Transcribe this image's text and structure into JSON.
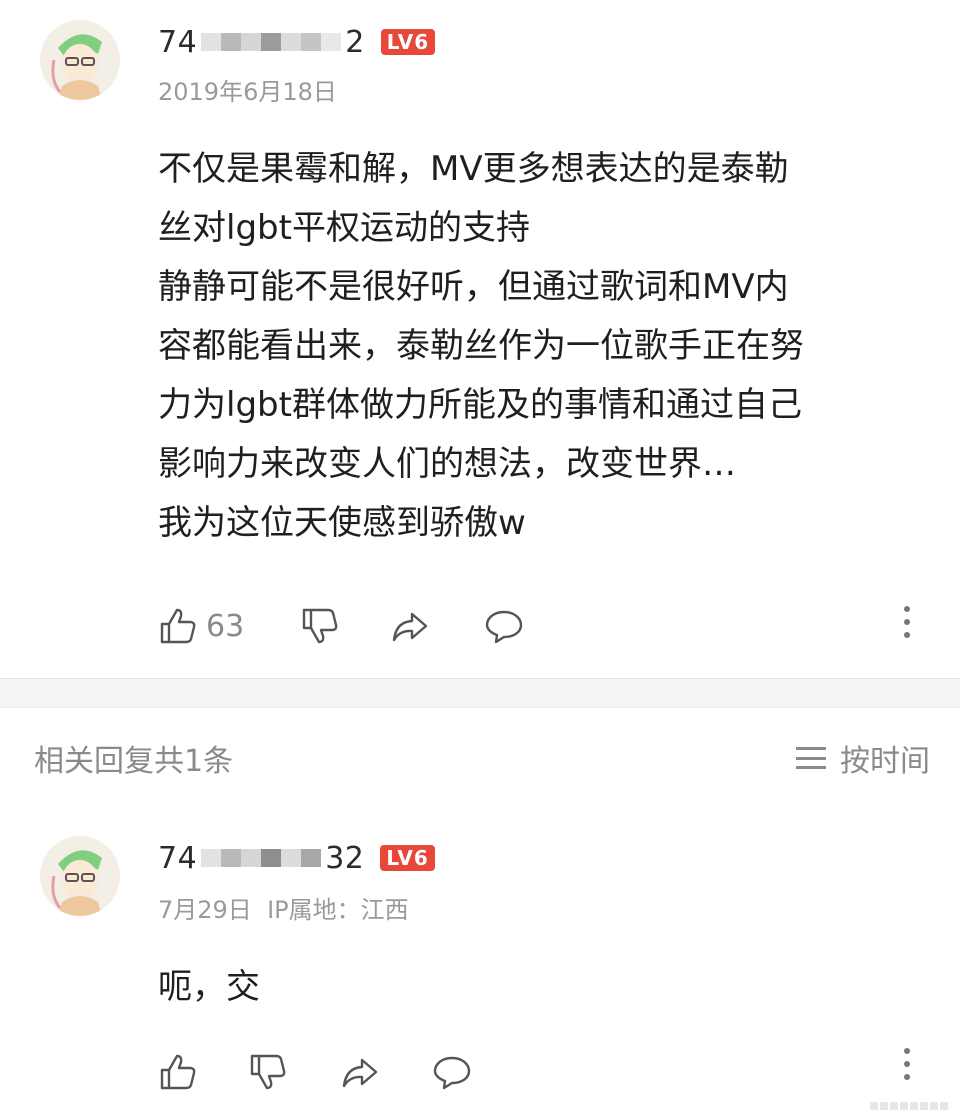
{
  "comments": [
    {
      "username_prefix": "74",
      "username_suffix": "2",
      "level": "LV6",
      "date": "2019年6月18日",
      "lines": [
        "不仅是果霉和解，MV更多想表达的是泰勒",
        "丝对lgbt平权运动的支持",
        "静静可能不是很好听，但通过歌词和MV内",
        "容都能看出来，泰勒丝作为一位歌手正在努",
        "力为lgbt群体做力所能及的事情和通过自己",
        "影响力来改变人们的想法，改变世界…",
        "我为这位天使感到骄傲w"
      ],
      "like_count": "63"
    }
  ],
  "replies": {
    "header": "相关回复共1条",
    "sort_label": "按时间",
    "items": [
      {
        "username_prefix": "74",
        "username_suffix": "32",
        "level": "LV6",
        "meta": "7月29日  IP属地：江西",
        "text": "呃，交",
        "like_count": ""
      }
    ]
  },
  "icons": {
    "like": "thumbs-up-icon",
    "dislike": "thumbs-down-icon",
    "share": "share-arrow-icon",
    "comment": "comment-bubble-icon",
    "more": "more-vertical-icon",
    "sort": "menu-lines-icon"
  },
  "colors": {
    "level_badge": "#e8483a",
    "muted_text": "#9a9a9a",
    "body_text": "#1f1f1f"
  }
}
